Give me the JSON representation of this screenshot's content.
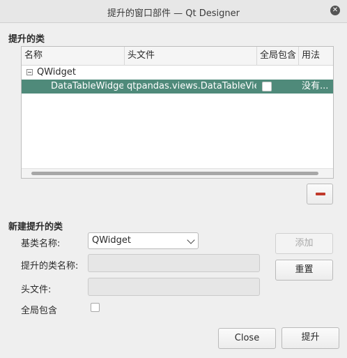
{
  "window": {
    "title": "提升的窗口部件 — Qt Designer",
    "close_symbol": "✕"
  },
  "promoted": {
    "section_title": "提升的类",
    "columns": [
      "名称",
      "头文件",
      "全局包含",
      "用法"
    ],
    "base_item": {
      "name": "QWidget"
    },
    "class_item": {
      "name": "DataTableWidget",
      "header": "qtpandas.views.DataTableView",
      "global_include": false,
      "usage": "没有..."
    }
  },
  "new_section": {
    "title": "新建提升的类",
    "base_class_label": "基类名称:",
    "base_class_value": "QWidget",
    "promoted_name_label": "提升的类名称:",
    "promoted_name_value": "",
    "header_label": "头文件:",
    "header_value": "",
    "global_include_label": "全局包含",
    "global_include_checked": false,
    "add_button": "添加",
    "reset_button": "重置"
  },
  "footer": {
    "close_button": "Close",
    "promote_button": "提升"
  },
  "colors": {
    "selection": "#4f8a7a",
    "remove_icon": "#c0392b"
  }
}
